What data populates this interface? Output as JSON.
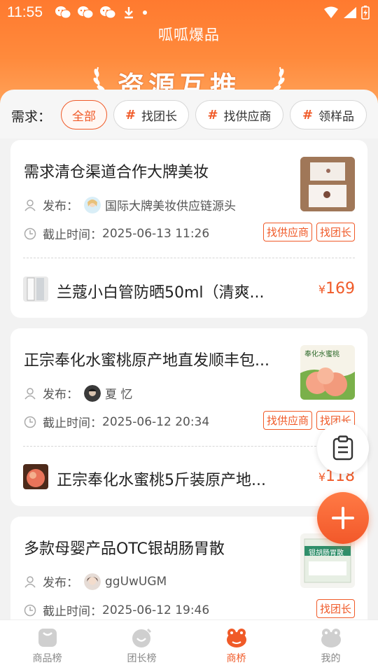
{
  "status_bar": {
    "time": "11:55",
    "icons": [
      "wechat-icon",
      "wechat-icon",
      "wechat-icon",
      "download-icon",
      "dot-icon"
    ],
    "right_icons": [
      "wifi-icon",
      "signal-icon",
      "battery-icon"
    ]
  },
  "app": {
    "title": "呱呱爆品"
  },
  "banner": {
    "text": "资源互推"
  },
  "filter": {
    "label": "需求：",
    "chips": [
      {
        "label": "全部",
        "active": true
      },
      {
        "label": "找团长",
        "active": false
      },
      {
        "label": "找供应商",
        "active": false
      },
      {
        "label": "领样品",
        "active": false
      }
    ]
  },
  "cards": [
    {
      "title": "需求清仓渠道合作大牌美妆",
      "publisher_label": "发布：",
      "publisher": "国际大牌美妆供应链源头",
      "deadline_label": "截止时间：",
      "deadline": "2025-06-13 11:26",
      "tags": [
        "找供应商",
        "找团长"
      ],
      "product_name": "兰蔻小白管防晒50ml（清爽...",
      "currency": "¥",
      "price": "169"
    },
    {
      "title": "正宗奉化水蜜桃原产地直发顺丰包...",
      "publisher_label": "发布：",
      "publisher": "夏 忆",
      "deadline_label": "截止时间：",
      "deadline": "2025-06-12 20:34",
      "tags": [
        "找供应商",
        "找团长"
      ],
      "thumb_text": "奉化水蜜桃",
      "product_name": "正宗奉化水蜜桃5斤装原产地...",
      "currency": "¥",
      "price": "118"
    },
    {
      "title": "多款母婴产品OTC银胡肠胃散",
      "publisher_label": "发布：",
      "publisher": "ggUwUGM",
      "deadline_label": "截止时间：",
      "deadline": "2025-06-12 19:46",
      "tags": [
        "找团长"
      ],
      "thumb_text": "银胡肠胃散"
    }
  ],
  "nav": {
    "items": [
      {
        "label": "商品榜",
        "icon": "bag-icon",
        "active": false
      },
      {
        "label": "团长榜",
        "icon": "smile-icon",
        "active": false
      },
      {
        "label": "商桥",
        "icon": "frog-icon",
        "active": true
      },
      {
        "label": "我的",
        "icon": "profile-icon",
        "active": false
      }
    ]
  },
  "colors": {
    "accent": "#f05a28",
    "header": "#ff7a2f"
  }
}
